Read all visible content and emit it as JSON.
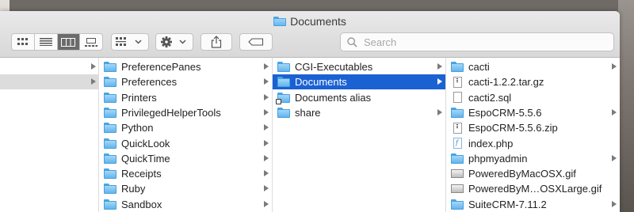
{
  "window": {
    "title": "Documents"
  },
  "toolbar": {
    "view_modes": [
      {
        "name": "icon-view-icon",
        "active": false
      },
      {
        "name": "list-view-icon",
        "active": false
      },
      {
        "name": "column-view-icon",
        "active": true
      },
      {
        "name": "gallery-view-icon",
        "active": false
      }
    ],
    "group_icon": "group-by-icon",
    "action_icon": "gear-icon",
    "share_icon": "share-icon",
    "tag_icon": "tag-icon",
    "search_placeholder": "Search"
  },
  "columns": {
    "col2": [
      {
        "label": "PreferencePanes",
        "kind": "folder"
      },
      {
        "label": "Preferences",
        "kind": "folder"
      },
      {
        "label": "Printers",
        "kind": "folder"
      },
      {
        "label": "PrivilegedHelperTools",
        "kind": "folder"
      },
      {
        "label": "Python",
        "kind": "folder"
      },
      {
        "label": "QuickLook",
        "kind": "folder"
      },
      {
        "label": "QuickTime",
        "kind": "folder"
      },
      {
        "label": "Receipts",
        "kind": "folder"
      },
      {
        "label": "Ruby",
        "kind": "folder"
      },
      {
        "label": "Sandbox",
        "kind": "folder"
      }
    ],
    "col3": [
      {
        "label": "CGI-Executables",
        "kind": "folder"
      },
      {
        "label": "Documents",
        "kind": "folder",
        "selected": true
      },
      {
        "label": "Documents alias",
        "kind": "alias"
      },
      {
        "label": "share",
        "kind": "folder"
      }
    ],
    "col4": [
      {
        "label": "cacti",
        "kind": "folder"
      },
      {
        "label": "cacti-1.2.2.tar.gz",
        "kind": "archive"
      },
      {
        "label": "cacti2.sql",
        "kind": "doc"
      },
      {
        "label": "EspoCRM-5.5.6",
        "kind": "folder"
      },
      {
        "label": "EspoCRM-5.5.6.zip",
        "kind": "archive"
      },
      {
        "label": "index.php",
        "kind": "php"
      },
      {
        "label": "phpmyadmin",
        "kind": "folder"
      },
      {
        "label": "PoweredByMacOSX.gif",
        "kind": "image"
      },
      {
        "label": "PoweredByM…OSXLarge.gif",
        "kind": "image"
      },
      {
        "label": "SuiteCRM-7.11.2",
        "kind": "folder"
      }
    ]
  },
  "colors": {
    "selection": "#1a61d4",
    "folder": "#62b5ee",
    "toolbar_bg": "#e2e1e2"
  }
}
